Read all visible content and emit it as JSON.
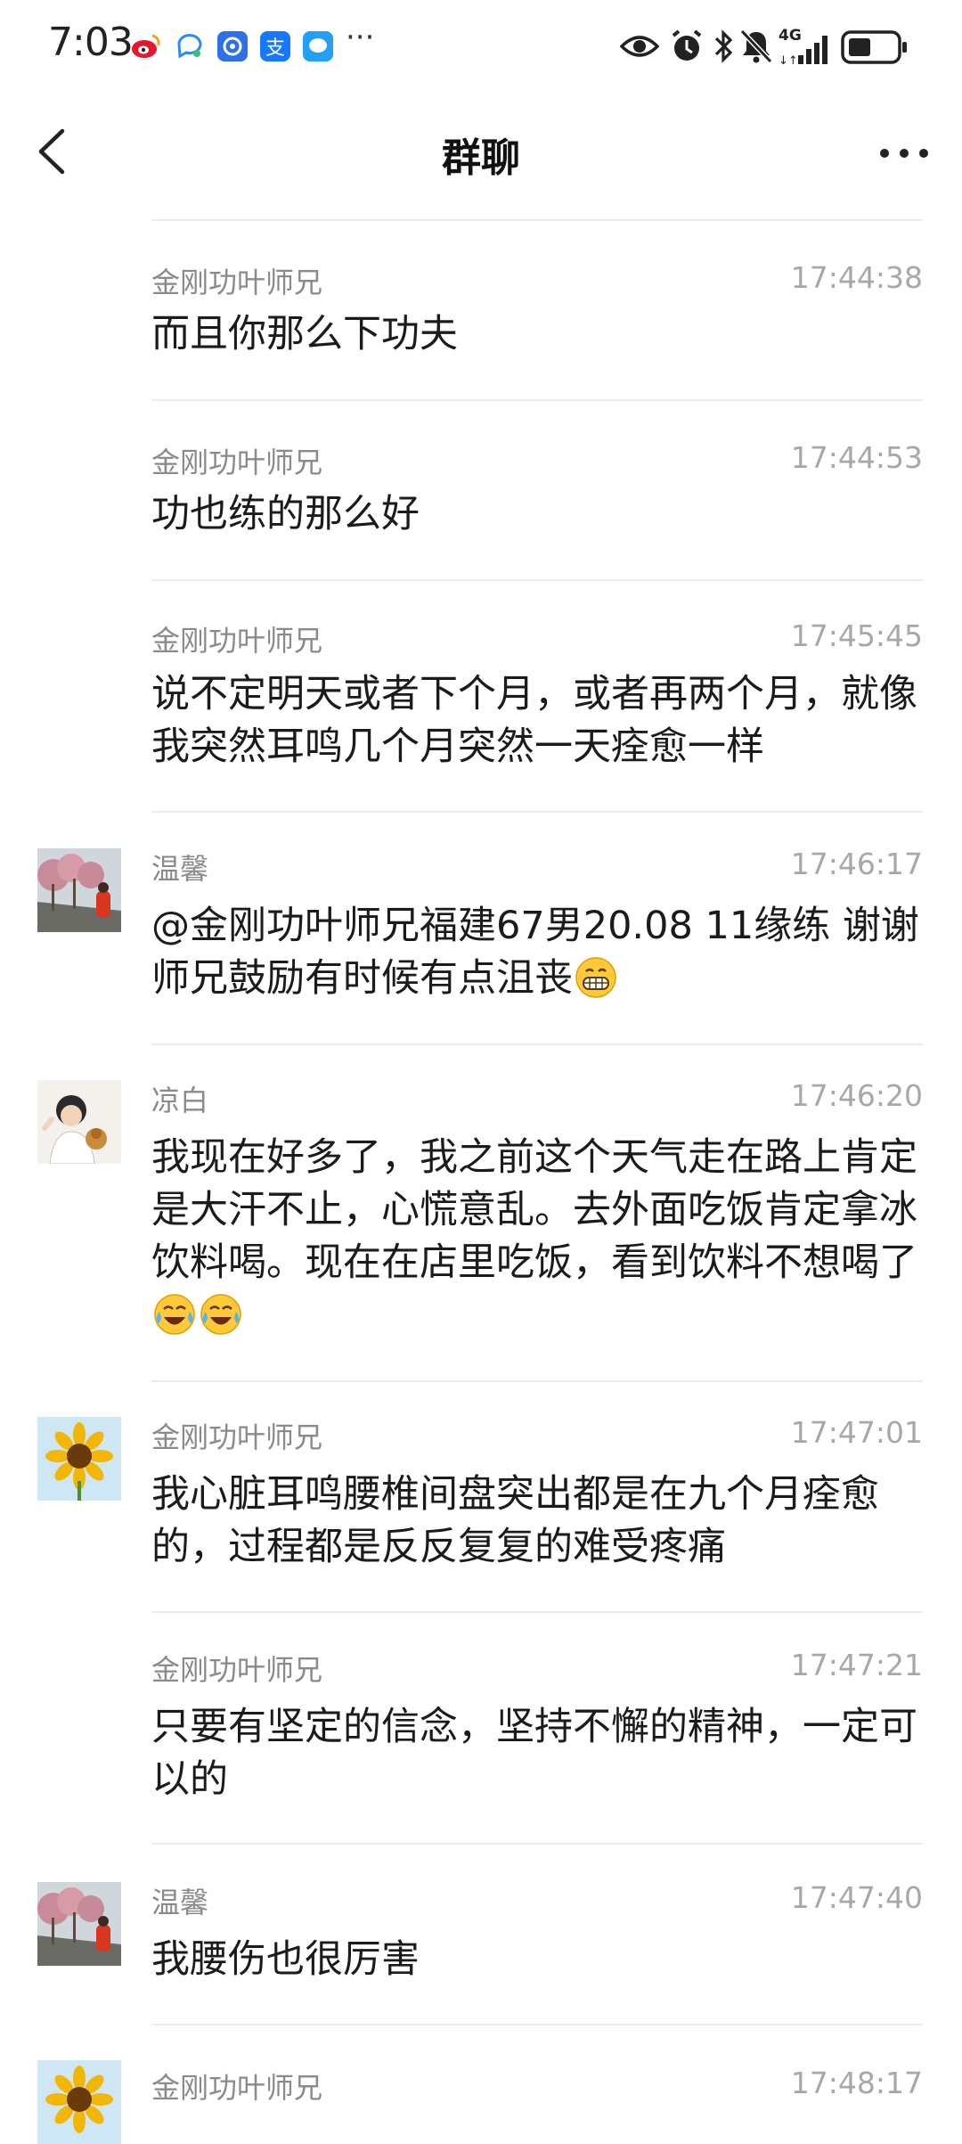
{
  "status_bar": {
    "time": "7:03",
    "more": "···",
    "network": "4G"
  },
  "header": {
    "title": "群聊"
  },
  "messages": [
    {
      "name": "金刚功叶师兄",
      "time": "17:44:38",
      "text": "而且你那么下功夫"
    },
    {
      "name": "金刚功叶师兄",
      "time": "17:44:53",
      "text": "功也练的那么好"
    },
    {
      "name": "金刚功叶师兄",
      "time": "17:45:45",
      "text": "说不定明天或者下个月，或者再两个月，就像我突然耳鸣几个月突然一天痊愈一样"
    },
    {
      "name": "温馨",
      "time": "17:46:17",
      "text": "@金刚功叶师兄福建67男20.08 11缘练 谢谢师兄鼓励有时候有点沮丧"
    },
    {
      "name": "凉白",
      "time": "17:46:20",
      "text": "我现在好多了，我之前这个天气走在路上肯定是大汗不止，心慌意乱。去外面吃饭肯定拿冰饮料喝。现在在店里吃饭，看到饮料不想喝了"
    },
    {
      "name": "金刚功叶师兄",
      "time": "17:47:01",
      "text": "我心脏耳鸣腰椎间盘突出都是在九个月痊愈的，过程都是反反复复的难受疼痛"
    },
    {
      "name": "金刚功叶师兄",
      "time": "17:47:21",
      "text": "只要有坚定的信念，坚持不懈的精神，一定可以的"
    },
    {
      "name": "温馨",
      "time": "17:47:40",
      "text": "我腰伤也很厉害"
    },
    {
      "name": "金刚功叶师兄",
      "time": "17:48:17",
      "text": ""
    }
  ]
}
